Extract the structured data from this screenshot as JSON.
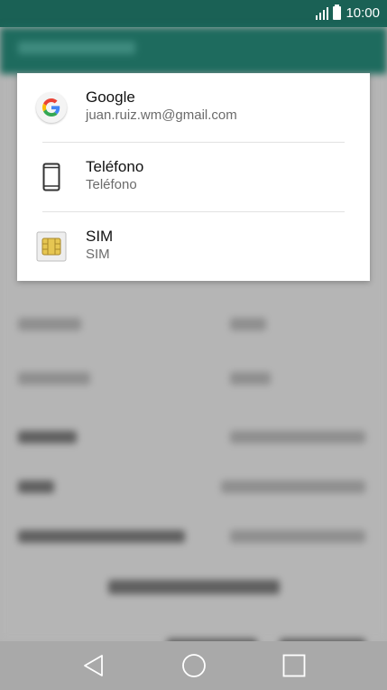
{
  "status_bar": {
    "time": "10:00",
    "icons": [
      "signal-icon",
      "battery-icon"
    ]
  },
  "dialog": {
    "accounts": [
      {
        "title": "Google",
        "subtitle": "juan.ruiz.wm@gmail.com",
        "icon": "google-icon"
      },
      {
        "title": "Teléfono",
        "subtitle": "Teléfono",
        "icon": "phone-icon"
      },
      {
        "title": "SIM",
        "subtitle": "SIM",
        "icon": "sim-card-icon"
      }
    ]
  },
  "nav_bar": {
    "icons": [
      "back-icon",
      "home-icon",
      "recents-icon"
    ]
  },
  "colors": {
    "status_bar": "#1a6155",
    "scrim": "#b3b3b3",
    "dialog_bg": "#ffffff"
  }
}
